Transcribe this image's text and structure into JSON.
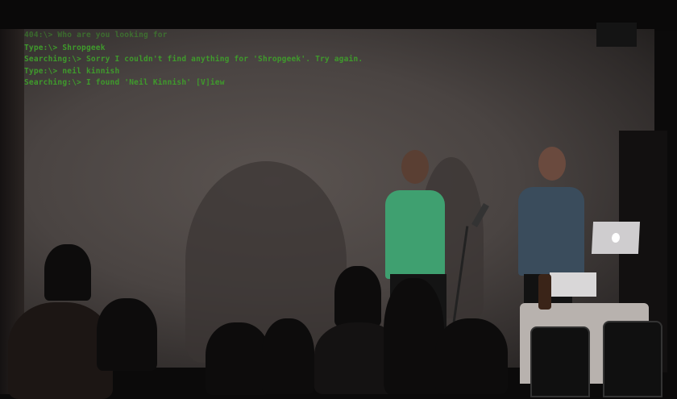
{
  "projection": {
    "lines": [
      "404:\\> Who are you looking for",
      "Type:\\> Shropgeek",
      "Searching:\\> Sorry I couldn't find anything for 'Shropgeek'. Try again.",
      "Type:\\> neil kinnish",
      "Searching:\\> I found 'Neil Kinnish' [V]iew"
    ],
    "text_color": "#3f9a2c"
  },
  "laptop_logo": "apple-logo-icon"
}
